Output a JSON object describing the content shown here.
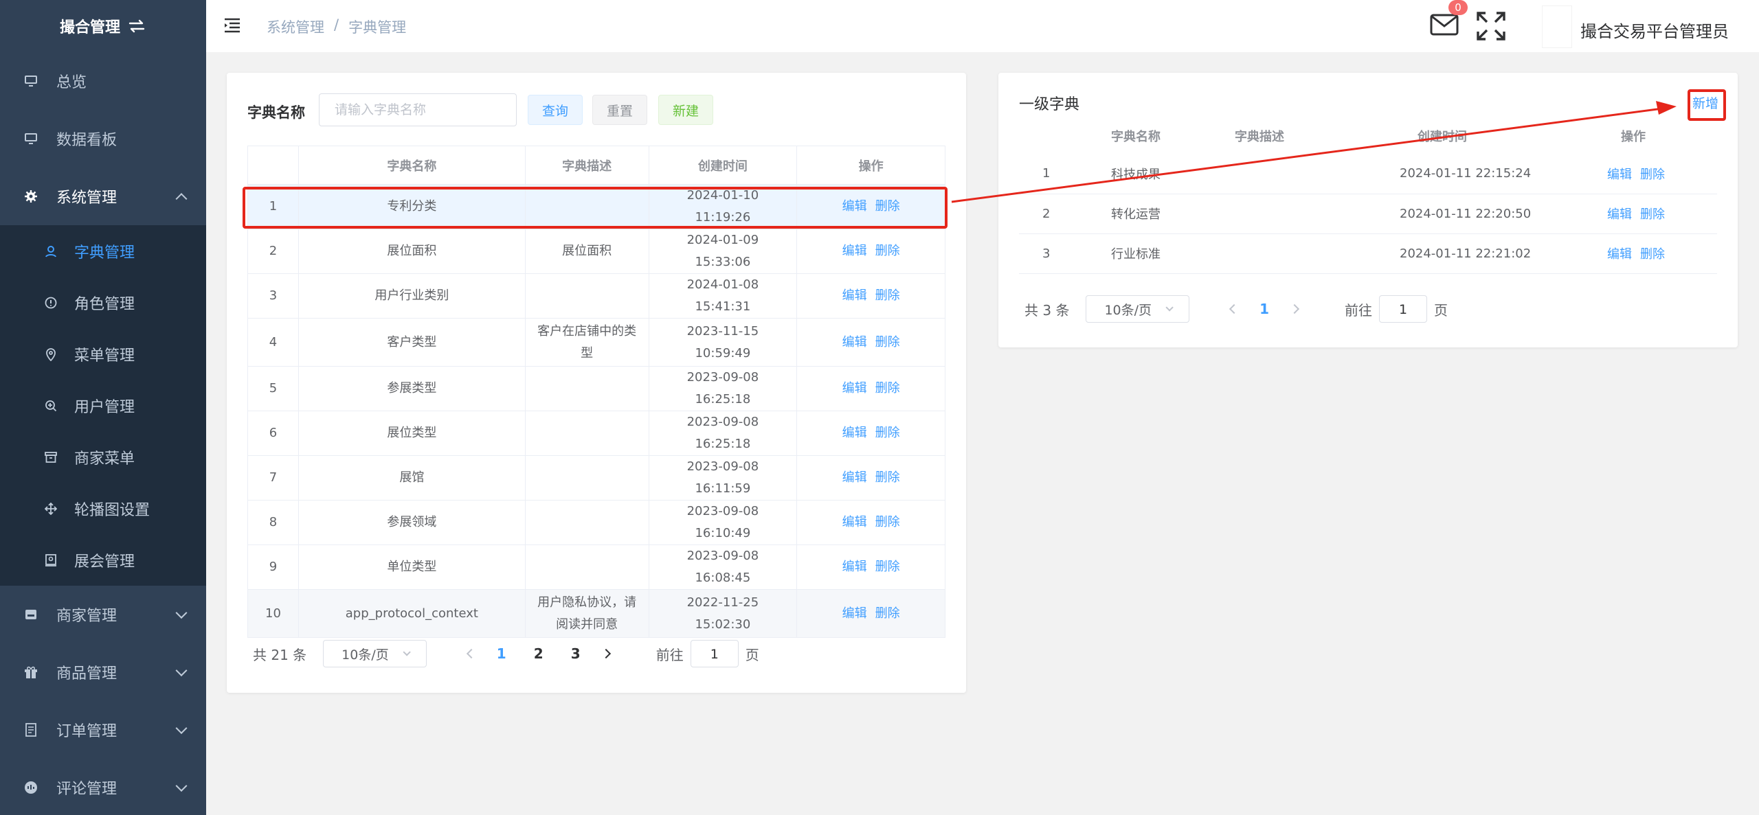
{
  "sidebar": {
    "logo_title": "撮合管理",
    "items": [
      {
        "label": "总览"
      },
      {
        "label": "数据看板"
      },
      {
        "label": "系统管理"
      },
      {
        "label": "商家管理"
      },
      {
        "label": "商品管理"
      },
      {
        "label": "订单管理"
      },
      {
        "label": "评论管理"
      }
    ],
    "subitems": [
      {
        "label": "字典管理"
      },
      {
        "label": "角色管理"
      },
      {
        "label": "菜单管理"
      },
      {
        "label": "用户管理"
      },
      {
        "label": "商家菜单"
      },
      {
        "label": "轮播图设置"
      },
      {
        "label": "展会管理"
      }
    ]
  },
  "header": {
    "breadcrumb": [
      "系统管理",
      "/",
      "字典管理"
    ],
    "badge_count": "0",
    "username": "撮合交易平台管理员"
  },
  "left": {
    "search_label": "字典名称",
    "search_placeholder": "请输入字典名称",
    "buttons": {
      "query": "查询",
      "reset": "重置",
      "new": "新建"
    },
    "columns": [
      "",
      "字典名称",
      "字典描述",
      "创建时间",
      "操作"
    ],
    "rows": [
      {
        "no": "1",
        "name": "专利分类",
        "desc": "",
        "time": "2024-01-10 11:19:26"
      },
      {
        "no": "2",
        "name": "展位面积",
        "desc": "展位面积",
        "time": "2024-01-09 15:33:06"
      },
      {
        "no": "3",
        "name": "用户行业类别",
        "desc": "",
        "time": "2024-01-08 15:41:31"
      },
      {
        "no": "4",
        "name": "客户类型",
        "desc": "客户在店铺中的类型",
        "time": "2023-11-15 10:59:49"
      },
      {
        "no": "5",
        "name": "参展类型",
        "desc": "",
        "time": "2023-09-08 16:25:18"
      },
      {
        "no": "6",
        "name": "展位类型",
        "desc": "",
        "time": "2023-09-08 16:25:18"
      },
      {
        "no": "7",
        "name": "展馆",
        "desc": "",
        "time": "2023-09-08 16:11:59"
      },
      {
        "no": "8",
        "name": "参展领域",
        "desc": "",
        "time": "2023-09-08 16:10:49"
      },
      {
        "no": "9",
        "name": "单位类型",
        "desc": "",
        "time": "2023-09-08 16:08:45"
      },
      {
        "no": "10",
        "name": "app_protocol_context",
        "desc": "用户隐私协议，请阅读并同意",
        "time": "2022-11-25 15:02:30"
      }
    ],
    "action_edit": "编辑",
    "action_delete": "删除",
    "pager": {
      "total": "共 21 条",
      "size": "10条/页",
      "pages": [
        "1",
        "2",
        "3"
      ],
      "goto_prefix": "前往",
      "goto_value": "1",
      "goto_suffix": "页"
    }
  },
  "right": {
    "title": "一级字典",
    "add": "新增",
    "columns": [
      "",
      "字典名称",
      "字典描述",
      "创建时间",
      "操作"
    ],
    "rows": [
      {
        "no": "1",
        "name": "科技成果",
        "desc": "",
        "time": "2024-01-11 22:15:24"
      },
      {
        "no": "2",
        "name": "转化运营",
        "desc": "",
        "time": "2024-01-11 22:20:50"
      },
      {
        "no": "3",
        "name": "行业标准",
        "desc": "",
        "time": "2024-01-11 22:21:02"
      }
    ],
    "action_edit": "编辑",
    "action_delete": "删除",
    "pager": {
      "total": "共 3 条",
      "size": "10条/页",
      "pages": [
        "1"
      ],
      "goto_prefix": "前往",
      "goto_value": "1",
      "goto_suffix": "页"
    }
  },
  "colors": {
    "accent": "#409eff",
    "sidebar": "#304156",
    "annotation": "#e5261b"
  }
}
